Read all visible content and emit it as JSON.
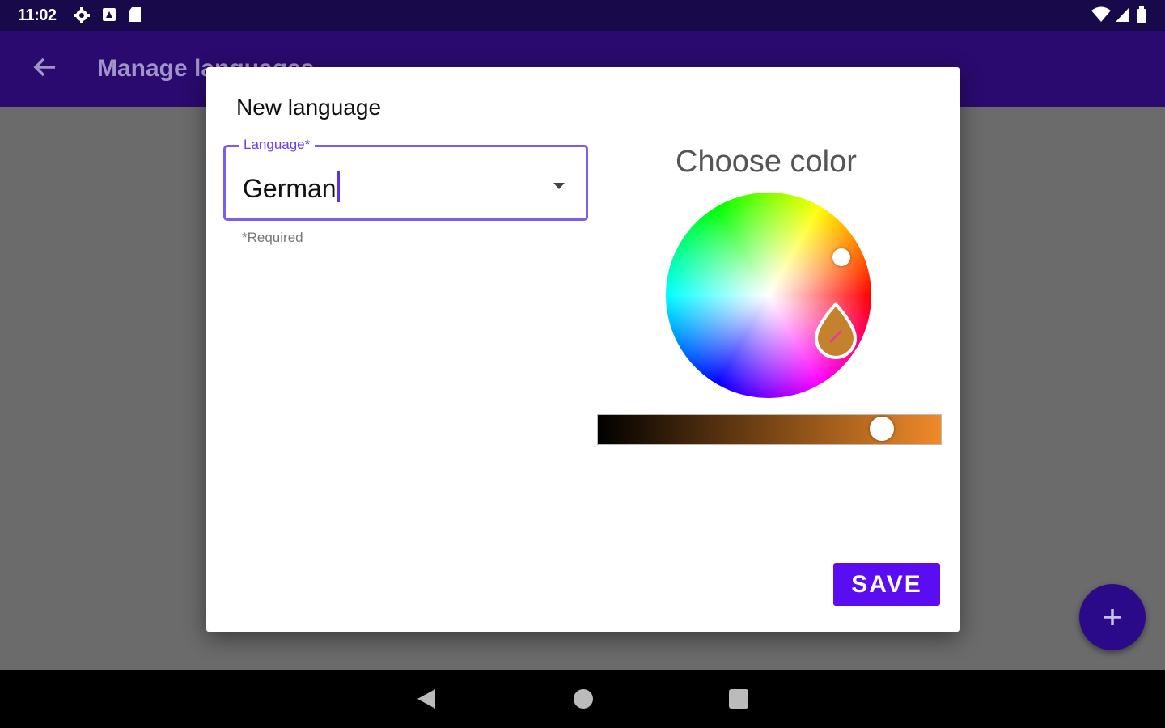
{
  "status_bar": {
    "time": "11:02",
    "icons": [
      "settings-icon",
      "notification-icon",
      "sd-card-icon",
      "wifi-icon",
      "signal-icon",
      "battery-icon"
    ]
  },
  "app_bar": {
    "title": "Manage languages",
    "back_icon": "arrow-back-icon",
    "color": "#2a0a6e"
  },
  "dialog": {
    "title": "New language",
    "language_field": {
      "label": "Language*",
      "value": "German",
      "helper": "*Required",
      "accent": "#7b5cf0"
    },
    "color_picker": {
      "title": "Choose color",
      "selected_color": "#c4822e",
      "brightness_end_color": "#f08a2a"
    },
    "save_label": "SAVE",
    "save_color": "#5a0df0"
  },
  "fab": {
    "icon": "plus-icon",
    "color": "#2b0a8a"
  },
  "nav_bar": {
    "buttons": [
      "back-triangle-icon",
      "home-circle-icon",
      "recents-square-icon"
    ]
  }
}
